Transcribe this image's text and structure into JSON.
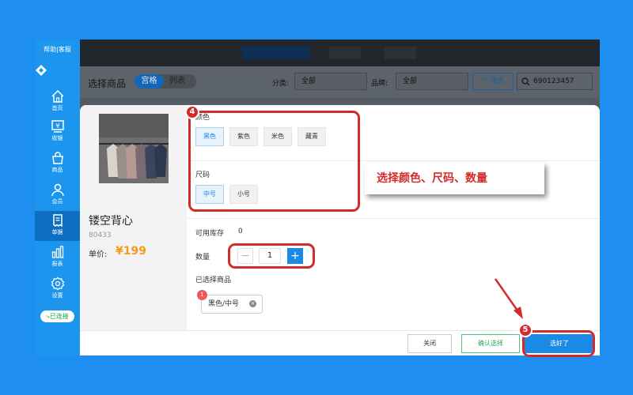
{
  "sidebar": {
    "help_link": "帮助",
    "service_link": "客服",
    "items": [
      {
        "label": "首页",
        "icon": "home-icon"
      },
      {
        "label": "收银",
        "icon": "cashier-icon"
      },
      {
        "label": "商品",
        "icon": "bag-icon"
      },
      {
        "label": "会员",
        "icon": "member-icon"
      },
      {
        "label": "单据",
        "icon": "receipt-icon"
      },
      {
        "label": "报表",
        "icon": "chart-icon"
      },
      {
        "label": "设置",
        "icon": "gear-icon"
      }
    ],
    "active_index": 4,
    "connected_label": "已连接"
  },
  "toolbar": {
    "title": "选择商品",
    "view_toggle": [
      "宫格",
      "列表"
    ],
    "category_label": "分类:",
    "category_value": "全部",
    "brand_label": "品牌:",
    "brand_value": "全部",
    "filter_label": "筛选",
    "search_value": "690123457"
  },
  "product": {
    "name": "镂空背心",
    "code": "80433",
    "price_label": "单价:",
    "price": "¥199"
  },
  "color_section": {
    "title": "颜色",
    "options": [
      "黑色",
      "紫色",
      "米色",
      "藏青"
    ],
    "selected": "黑色"
  },
  "size_section": {
    "title": "尺码",
    "options": [
      "中号",
      "小号"
    ],
    "selected": "中号"
  },
  "stock": {
    "label": "可用库存",
    "value": "0"
  },
  "quantity": {
    "label": "数量",
    "value": "1",
    "minus": "−",
    "plus": "+"
  },
  "selected_items": {
    "label": "已选择商品",
    "badge": "1",
    "chips": [
      "黑色/中号"
    ],
    "remove": "×"
  },
  "footer": {
    "close": "关闭",
    "confirm_select": "确认选择",
    "done": "选好了"
  },
  "annotations": {
    "step4": "4",
    "step5": "5",
    "callout": "选择颜色、尺码、数量",
    "highlight_color": "#d42a2a"
  },
  "colors": {
    "accent": "#1a8ae6",
    "sidebar_bg": "#1b95ee",
    "price": "#f39b1a",
    "page_bg": "#1e8ff0"
  }
}
